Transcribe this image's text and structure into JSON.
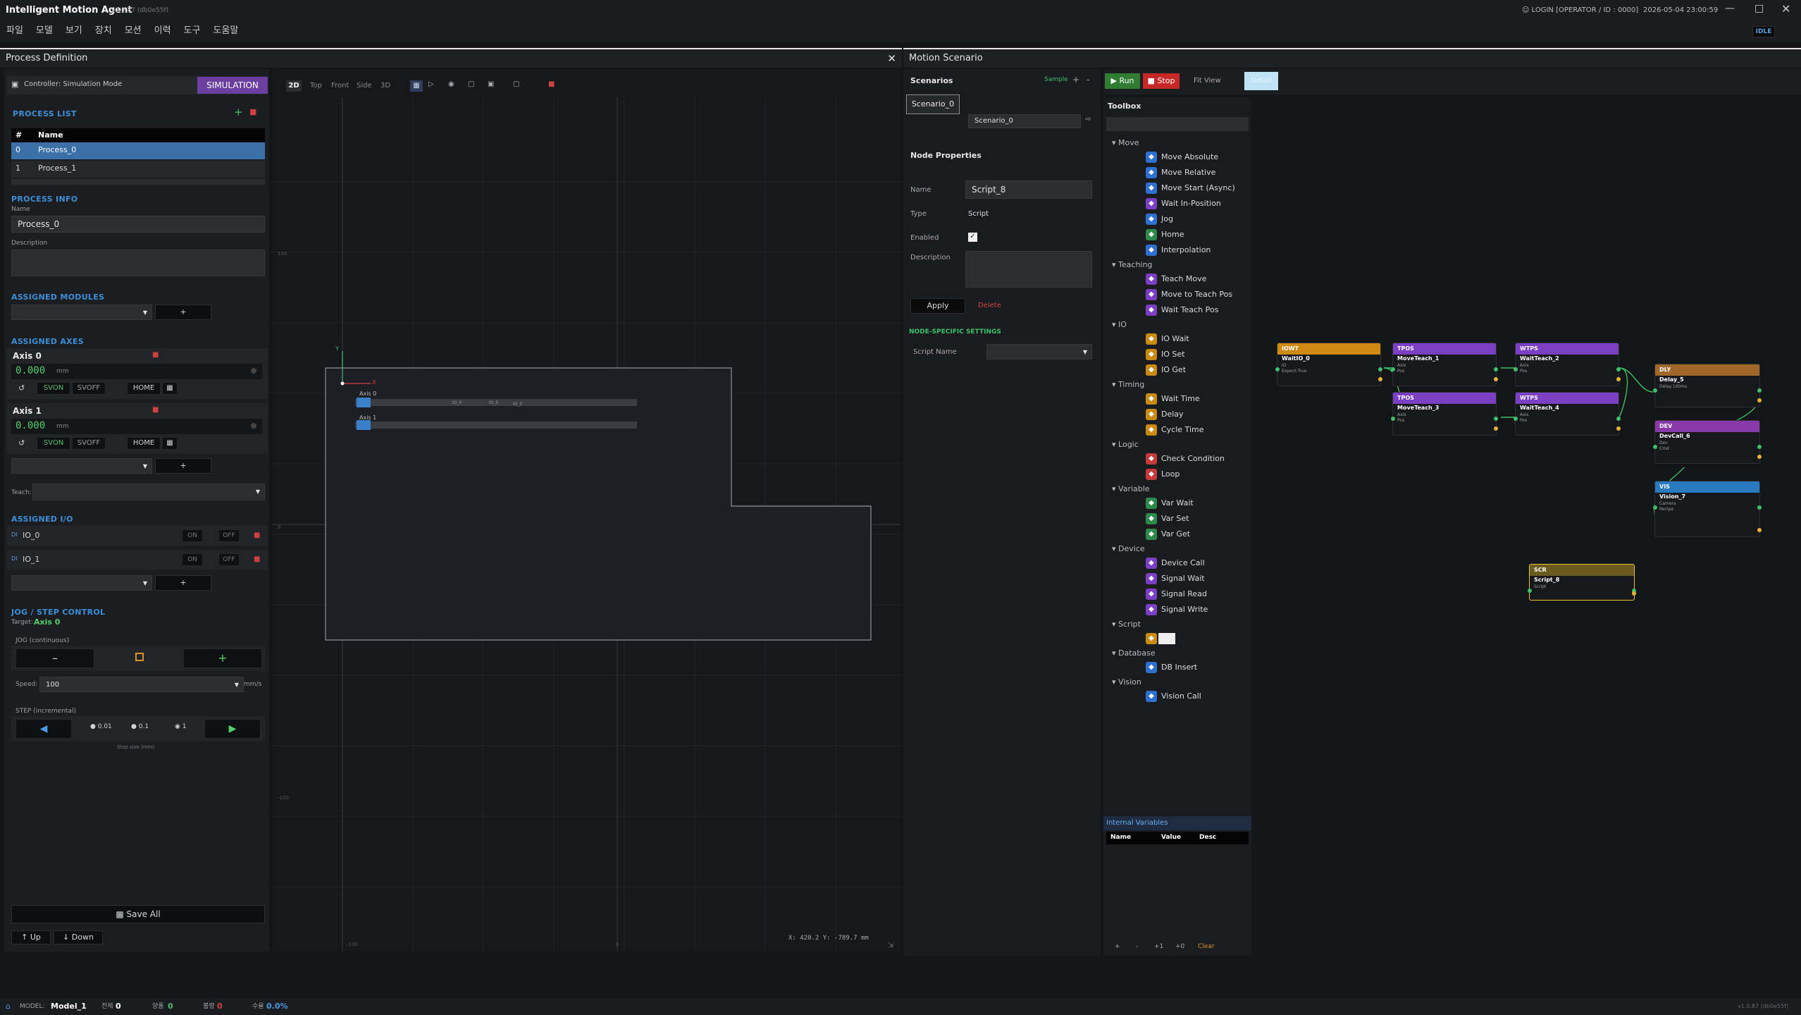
{
  "app": {
    "title": "Intelligent Motion Agent",
    "title_highlight_letters": "IMA",
    "version": "v1.0.87 (db0e55f)",
    "login": "LOGIN [OPERATOR / ID : 0000]",
    "datetime": "2026-05-04 23:00:59",
    "state": "IDLE"
  },
  "menu": [
    "파일",
    "모델",
    "보기",
    "장치",
    "모션",
    "이력",
    "도구",
    "도움말"
  ],
  "process_def": {
    "title": "Process Definition",
    "controller_label": "Controller: Simulation Mode",
    "mode_button": "SIMULATION",
    "process_list_title": "PROCESS LIST",
    "table_headers": [
      "#",
      "Name"
    ],
    "processes": [
      {
        "idx": "0",
        "name": "Process_0"
      },
      {
        "idx": "1",
        "name": "Process_1"
      }
    ],
    "process_info_title": "PROCESS INFO",
    "name_label": "Name",
    "name_value": "Process_0",
    "desc_label": "Description",
    "assigned_modules_title": "ASSIGNED MODULES",
    "add_label": "+",
    "assigned_axes_title": "ASSIGNED AXES",
    "axes": [
      {
        "name": "Axis 0",
        "value": "0.000",
        "unit": "mm",
        "svon": "SVON",
        "svoff": "SVOFF",
        "home": "HOME"
      },
      {
        "name": "Axis 1",
        "value": "0.000",
        "unit": "mm",
        "svon": "SVON",
        "svoff": "SVOFF",
        "home": "HOME"
      }
    ],
    "teach_label": "Teach:",
    "assigned_io_title": "ASSIGNED I/O",
    "ios": [
      {
        "tag": "DI",
        "name": "IO_0",
        "on": "ON",
        "off": "OFF"
      },
      {
        "tag": "DI",
        "name": "IO_1",
        "on": "ON",
        "off": "OFF"
      }
    ],
    "jog_title": "JOG / STEP CONTROL",
    "target_label": "Target:",
    "target_value": "Axis 0",
    "jog_cont_label": "JOG (continuous)",
    "speed_label": "Speed:",
    "speed_value": "100",
    "speed_unit": "mm/s",
    "step_label": "STEP (incremental)",
    "step_options": [
      "0.01",
      "0.1",
      "1"
    ],
    "step_selected": "1",
    "step_size_label": "Step size (mm)",
    "save_all": "Save All",
    "up": "Up",
    "down": "Down"
  },
  "viewport": {
    "views": [
      "2D",
      "Top",
      "Front",
      "Side",
      "3D"
    ],
    "active_view": "2D",
    "axis_y": "Y",
    "axis_x": "X",
    "tick_labels": [
      "100",
      "0",
      "-100",
      "-100",
      "0"
    ],
    "axis_labels": [
      "Axis 0",
      "Axis 1"
    ],
    "io_labels": [
      "IO_0",
      "IO_0",
      "IO_0"
    ],
    "coords": "X: 420.2  Y: -789.7 mm"
  },
  "motion": {
    "title": "Motion Scenario",
    "scenarios_title": "Scenarios",
    "sample_btn": "Sample",
    "scenario_item": "Scenario_0",
    "scenario_name_value": "Scenario_0",
    "run": "Run",
    "stop": "Stop",
    "fit_view": "Fit View",
    "detail": "Detail",
    "node_props_title": "Node Properties",
    "name_label": "Name",
    "name_value": "Script_8",
    "type_label": "Type",
    "type_value": "Script",
    "enabled_label": "Enabled",
    "description_label": "Description",
    "apply": "Apply",
    "delete": "Delete",
    "node_settings_title": "NODE-SPECIFIC SETTINGS",
    "script_name_label": "Script Name",
    "toolbox_title": "Toolbox",
    "internal_vars_title": "Internal Variables",
    "var_headers": [
      "Name",
      "Value",
      "Desc"
    ],
    "var_buttons": [
      "+",
      "-",
      "+1",
      "+0",
      "Clear"
    ]
  },
  "toolbox": [
    {
      "category": "Move",
      "items": [
        {
          "label": "Move Absolute",
          "icon": "move-absolute-icon",
          "color": "#2f6fd0"
        },
        {
          "label": "Move Relative",
          "icon": "move-relative-icon",
          "color": "#2f6fd0"
        },
        {
          "label": "Move Start (Async)",
          "icon": "play-icon",
          "color": "#2f6fd0"
        },
        {
          "label": "Wait In-Position",
          "icon": "wait-icon",
          "color": "#7b3fc4"
        },
        {
          "label": "Jog",
          "icon": "jog-icon",
          "color": "#2f6fd0"
        },
        {
          "label": "Home",
          "icon": "home-icon",
          "color": "#2e8a4a"
        },
        {
          "label": "Interpolation",
          "icon": "interpolation-icon",
          "color": "#2f6fd0"
        }
      ]
    },
    {
      "category": "Teaching",
      "items": [
        {
          "label": "Teach Move",
          "icon": "teach-icon",
          "color": "#7b3fc4"
        },
        {
          "label": "Move to Teach Pos",
          "icon": "arrow-icon",
          "color": "#7b3fc4"
        },
        {
          "label": "Wait Teach Pos",
          "icon": "wait-icon",
          "color": "#7b3fc4"
        }
      ]
    },
    {
      "category": "IO",
      "items": [
        {
          "label": "IO Wait",
          "icon": "io-wait-icon",
          "color": "#c98a12"
        },
        {
          "label": "IO Set",
          "icon": "io-set-icon",
          "color": "#c98a12"
        },
        {
          "label": "IO Get",
          "icon": "io-get-icon",
          "color": "#c98a12"
        }
      ]
    },
    {
      "category": "Timing",
      "items": [
        {
          "label": "Wait Time",
          "icon": "clock-icon",
          "color": "#c98a12"
        },
        {
          "label": "Delay",
          "icon": "delay-icon",
          "color": "#c98a12"
        },
        {
          "label": "Cycle Time",
          "icon": "cycle-icon",
          "color": "#c98a12"
        }
      ]
    },
    {
      "category": "Logic",
      "items": [
        {
          "label": "Check Condition",
          "icon": "condition-icon",
          "color": "#c43a3a"
        },
        {
          "label": "Loop",
          "icon": "loop-icon",
          "color": "#c43a3a"
        }
      ]
    },
    {
      "category": "Variable",
      "items": [
        {
          "label": "Var Wait",
          "icon": "var-wait-icon",
          "color": "#2e8a4a"
        },
        {
          "label": "Var Set",
          "icon": "var-set-icon",
          "color": "#2e8a4a"
        },
        {
          "label": "Var Get",
          "icon": "var-get-icon",
          "color": "#2e8a4a"
        }
      ]
    },
    {
      "category": "Device",
      "items": [
        {
          "label": "Device Call",
          "icon": "device-call-icon",
          "color": "#7b3fc4"
        },
        {
          "label": "Signal Wait",
          "icon": "signal-wait-icon",
          "color": "#7b3fc4"
        },
        {
          "label": "Signal Read",
          "icon": "signal-read-icon",
          "color": "#7b3fc4"
        },
        {
          "label": "Signal Write",
          "icon": "signal-write-icon",
          "color": "#7b3fc4"
        }
      ]
    },
    {
      "category": "Script",
      "items": [
        {
          "label": "",
          "icon": "script-icon",
          "color": "#c98a12"
        }
      ]
    },
    {
      "category": "Database",
      "items": [
        {
          "label": "DB Insert",
          "icon": "db-insert-icon",
          "color": "#2f6fd0"
        }
      ]
    },
    {
      "category": "Vision",
      "items": [
        {
          "label": "Vision Call",
          "icon": "vision-icon",
          "color": "#2f6fd0"
        }
      ]
    }
  ],
  "nodes": [
    {
      "id": "waitio",
      "tag": "IOWT",
      "name": "WaitIO_0",
      "params": [
        "IO",
        "Expect:True"
      ],
      "color": "#d08a12"
    },
    {
      "id": "mt1",
      "tag": "TPOS",
      "name": "MoveTeach_1",
      "params": [
        "Axis",
        "Pos"
      ],
      "color": "#7b3fc4"
    },
    {
      "id": "wt2",
      "tag": "WTPS",
      "name": "WaitTeach_2",
      "params": [
        "Axis",
        "Pos"
      ],
      "color": "#7b3fc4"
    },
    {
      "id": "mt3",
      "tag": "TPOS",
      "name": "MoveTeach_3",
      "params": [
        "Axis",
        "Pos"
      ],
      "color": "#7b3fc4"
    },
    {
      "id": "wt4",
      "tag": "WTPS",
      "name": "WaitTeach_4",
      "params": [
        "Axis",
        "Pos"
      ],
      "color": "#7b3fc4"
    },
    {
      "id": "delay5",
      "tag": "DLY",
      "name": "Delay_5",
      "params": [
        "Delay:100ms"
      ],
      "color": "#a0662a"
    },
    {
      "id": "dev6",
      "tag": "DEV",
      "name": "DevCall_6",
      "params": [
        "Dev",
        "Cmd"
      ],
      "color": "#8a3aa8"
    },
    {
      "id": "vis7",
      "tag": "VIS",
      "name": "Vision_7",
      "params": [
        "Camera",
        "Recipe"
      ],
      "color": "#2a7ac0"
    },
    {
      "id": "scr8",
      "tag": "SCR",
      "name": "Script_8",
      "params": [
        "Script"
      ],
      "color": "#6a5a1e"
    }
  ],
  "status": {
    "model_label": "MODEL:",
    "model_value": "Model_1",
    "counters": [
      {
        "label": "전체",
        "value": "0"
      },
      {
        "label": "양품",
        "value": "0"
      },
      {
        "label": "불량",
        "value": "0"
      },
      {
        "label": "수율",
        "value": "0.0%"
      }
    ],
    "version": "v1.0.87 (db0e55f)"
  },
  "colors": {
    "accent": "#3d8fd8",
    "run": "#2e7d32",
    "stop": "#c62828",
    "simulation": "#6a3fa0",
    "selected_row": "#3a6fa8"
  }
}
